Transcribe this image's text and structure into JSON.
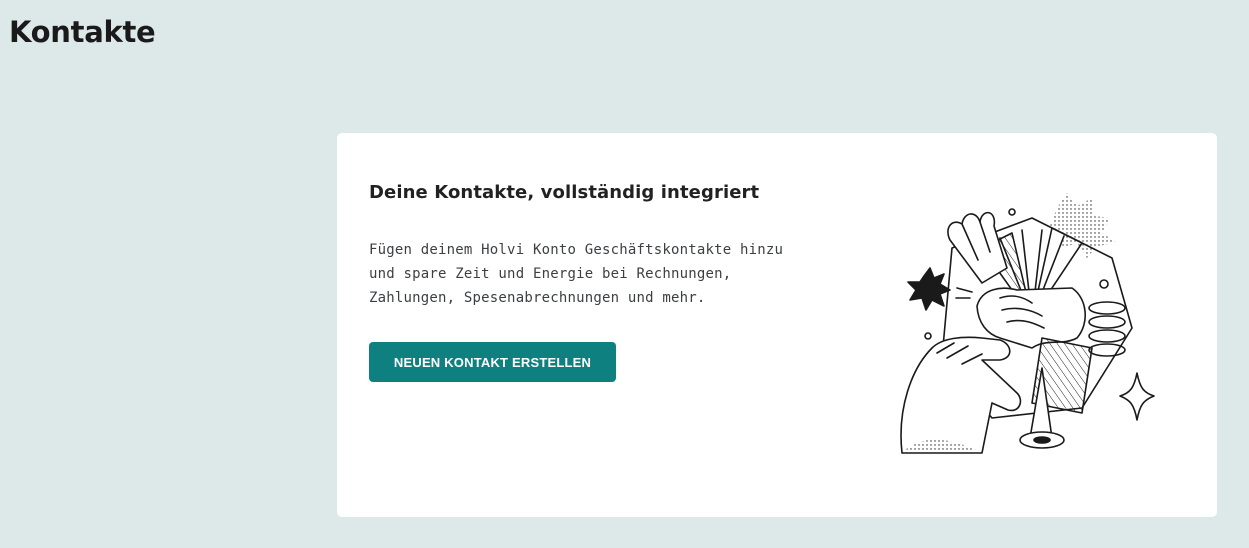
{
  "page": {
    "title": "Kontakte"
  },
  "empty_state": {
    "heading": "Deine Kontakte, vollständig integriert",
    "description": "Fügen deinem Holvi Konto Geschäftskontakte hinzu und spare Zeit und Energie bei Rechnungen, Zahlungen, Spesenabrechnungen und mehr.",
    "cta_label": "NEUEN KONTAKT ERSTELLEN",
    "illustration": "handshake-illustration"
  },
  "colors": {
    "background": "#dde8e9",
    "card": "#ffffff",
    "primary_button": "#0f8080",
    "text": "#1d1d1f"
  }
}
